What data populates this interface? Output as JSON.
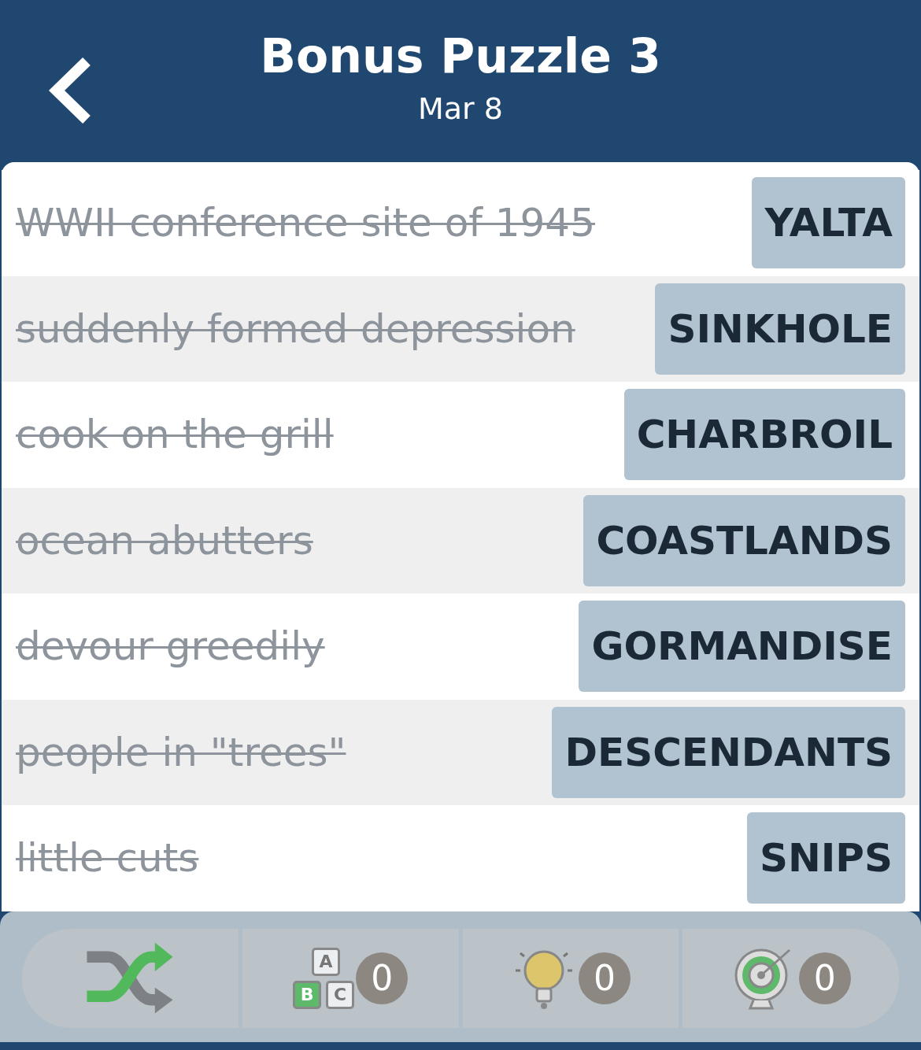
{
  "header": {
    "title": "Bonus Puzzle 3",
    "date": "Mar 8"
  },
  "clues": [
    {
      "clue": "WWII conference site of 1945",
      "answer": "YALTA",
      "solved": true
    },
    {
      "clue": "suddenly formed depression",
      "answer": "SINKHOLE",
      "solved": true
    },
    {
      "clue": "cook on the grill",
      "answer": "CHARBROIL",
      "solved": true
    },
    {
      "clue": "ocean abutters",
      "answer": "COASTLANDS",
      "solved": true
    },
    {
      "clue": "devour greedily",
      "answer": "GORMANDISE",
      "solved": true
    },
    {
      "clue": "people in \"trees\"",
      "answer": "DESCENDANTS",
      "solved": true
    },
    {
      "clue": "little cuts",
      "answer": "SNIPS",
      "solved": true
    }
  ],
  "toolbar": [
    {
      "kind": "shuffle"
    },
    {
      "kind": "letters",
      "letters": [
        "A",
        "B",
        "C"
      ],
      "count": "0"
    },
    {
      "kind": "hint",
      "count": "0"
    },
    {
      "kind": "target",
      "count": "0"
    }
  ]
}
